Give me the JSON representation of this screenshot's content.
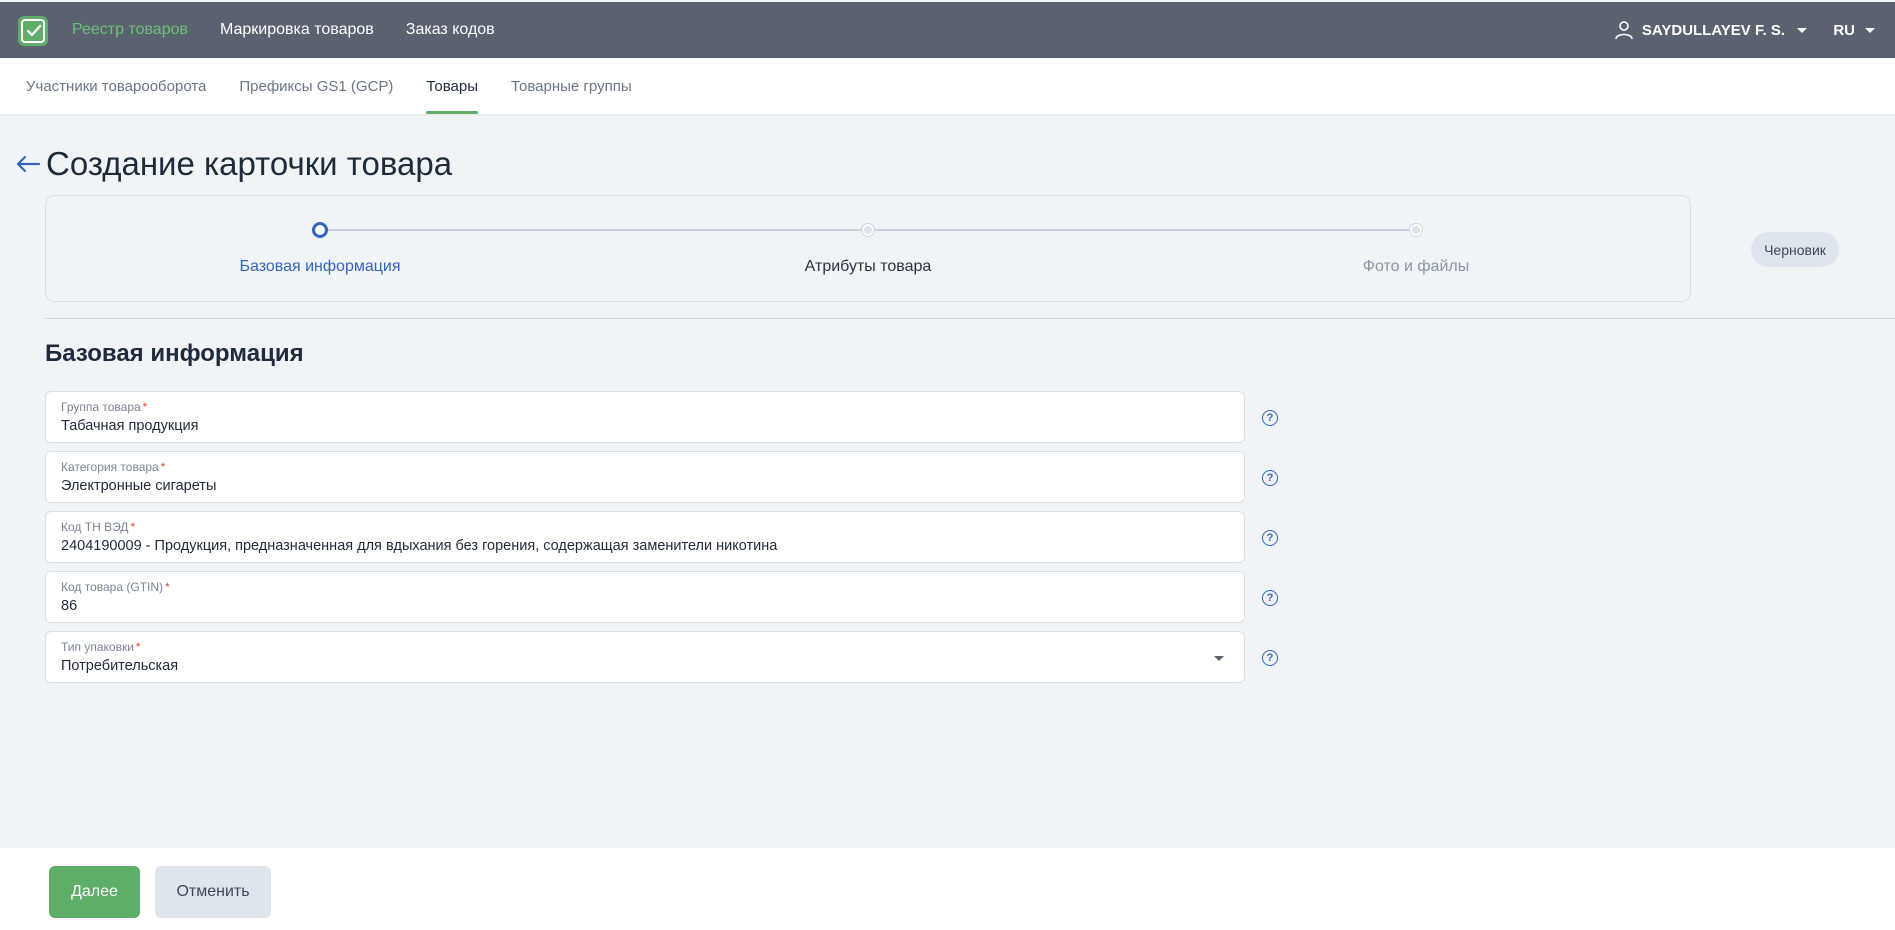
{
  "topbar": {
    "nav": [
      {
        "label": "Реестр товаров",
        "active": true
      },
      {
        "label": "Маркировка товаров",
        "active": false
      },
      {
        "label": "Заказ кодов",
        "active": false
      }
    ],
    "user_name": "SAYDULLAYEV F. S.",
    "language": "RU"
  },
  "subnav": {
    "tabs": [
      {
        "label": "Участники товарооборота",
        "active": false
      },
      {
        "label": "Префиксы GS1 (GCP)",
        "active": false
      },
      {
        "label": "Товары",
        "active": true
      },
      {
        "label": "Товарные группы",
        "active": false
      }
    ]
  },
  "page_title": "Создание карточки товара",
  "stepper": {
    "steps": [
      {
        "label": "Базовая информация",
        "state": "active"
      },
      {
        "label": "Атрибуты товара",
        "state": "normal"
      },
      {
        "label": "Фото и файлы",
        "state": "muted"
      }
    ]
  },
  "status_badge": "Черновик",
  "section_title": "Базовая информация",
  "fields": [
    {
      "label": "Группа товара",
      "required": "*",
      "value": "Табачная продукция"
    },
    {
      "label": "Категория товара",
      "required": "*",
      "value": "Электронные сигареты"
    },
    {
      "label": "Код ТН ВЭД",
      "required": "*",
      "value": "2404190009 - Продукция, предназначенная для вдыхания без горения, содержащая заменители никотина"
    },
    {
      "label": "Код товара (GTIN)",
      "required": "*",
      "value": "86"
    },
    {
      "label": "Тип упаковки",
      "required": "*",
      "value": "Потребительская"
    }
  ],
  "footer": {
    "next_label": "Далее",
    "cancel_label": "Отменить"
  },
  "colors": {
    "accent_green": "#5fae68",
    "accent_blue": "#3465c0",
    "topbar_bg": "#5a6270",
    "required": "#e0463b"
  }
}
